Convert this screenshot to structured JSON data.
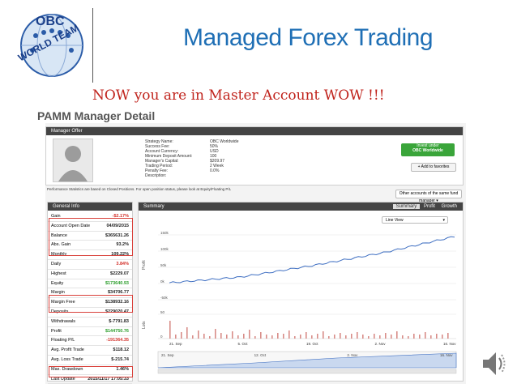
{
  "header": {
    "logo_line1": "OBC",
    "logo_line2": "WORLD TEAM",
    "title": "Managed Forex Trading",
    "subtitle": "NOW  you are in Master Account  WOW !!!"
  },
  "page": {
    "heading": "PAMM Manager Detail"
  },
  "offer": {
    "panel_title": "Manager Offer",
    "labels": [
      "Strategy Name:",
      "Success Fee:",
      "Account Currency:",
      "Minimum Deposit Amount:",
      "Manager's Capital:",
      "Trading Period:",
      "Penalty Fee:",
      "Description:"
    ],
    "values": [
      "OBC Worldwide",
      "50%",
      "USD",
      "100",
      "$209.97",
      "2 Week",
      "0.0%",
      ""
    ],
    "invest_button_line1": "Invest under",
    "invest_button_line2": "OBC Worldwide",
    "favorites_button": "+ Add to favorites",
    "note": "Performance Statistics are based on Closed Positions. For open position status, please look at Equity/Floating P/L",
    "other_accounts": "Other accounts of the same fund manager"
  },
  "general_info": {
    "panel_title": "General Info",
    "rows": [
      {
        "label": "Gain",
        "value": "-$2.17%"
      },
      {
        "label": "Account Open Date",
        "value": "04/09/2015"
      },
      {
        "label": "Balance",
        "value": "$365631.26"
      },
      {
        "label": "Abs. Gain",
        "value": "93.2%"
      },
      {
        "label": "Monthly",
        "value": "109.22%"
      },
      {
        "label": "Daily",
        "value": "3.84%"
      },
      {
        "label": "Highest",
        "value": "$2229.07"
      },
      {
        "label": "Equity",
        "value": "$173640.93"
      },
      {
        "label": "Margin",
        "value": "$34706.77"
      },
      {
        "label": "Margin Free",
        "value": "$138932.16"
      },
      {
        "label": "Deposits",
        "value": "$229020.47"
      },
      {
        "label": "Withdrawals",
        "value": "$-7791.83"
      },
      {
        "label": "Profit",
        "value": "$144750.76"
      },
      {
        "label": "Floating P/L",
        "value": "-191364.35"
      },
      {
        "label": "Avg. Profit Trade",
        "value": "$118.12"
      },
      {
        "label": "Avg. Loss Trade",
        "value": "$-215.74"
      },
      {
        "label": "Max. Drawdown",
        "value": "1.46%"
      },
      {
        "label": "Last Update",
        "value": "2015/11/17 17:05:33"
      }
    ]
  },
  "summary": {
    "panel_title": "Summary",
    "tabs": [
      "Summary",
      "Profit",
      "Growth"
    ],
    "view_select": "Line View",
    "profit_axis_label": "Profit",
    "lots_axis_label": "Lots",
    "y_ticks": [
      "150k",
      "100k",
      "50k",
      "0k",
      "-50k"
    ],
    "lots_ticks": [
      "50",
      "0"
    ],
    "x_ticks": [
      "21. Sep",
      "5. Oct",
      "19. Oct",
      "2. Nov",
      "16. Nov"
    ],
    "nav_ticks": [
      "21. Sep",
      "12. Oct",
      "2. Nov",
      "16. Nov"
    ],
    "colors": {
      "line": "#3f6fc2",
      "bars": "#d88d88",
      "nav_fill": "#c9d8ef"
    }
  },
  "chart_data": {
    "type": "line",
    "title": "",
    "xlabel": "",
    "ylabel": "Profit",
    "x": [
      "21. Sep",
      "5. Oct",
      "19. Oct",
      "2. Nov",
      "16. Nov"
    ],
    "series": [
      {
        "values": [
          2000,
          20000,
          55000,
          95000,
          145000
        ]
      }
    ],
    "ylim": [
      -50000,
      150000
    ]
  }
}
